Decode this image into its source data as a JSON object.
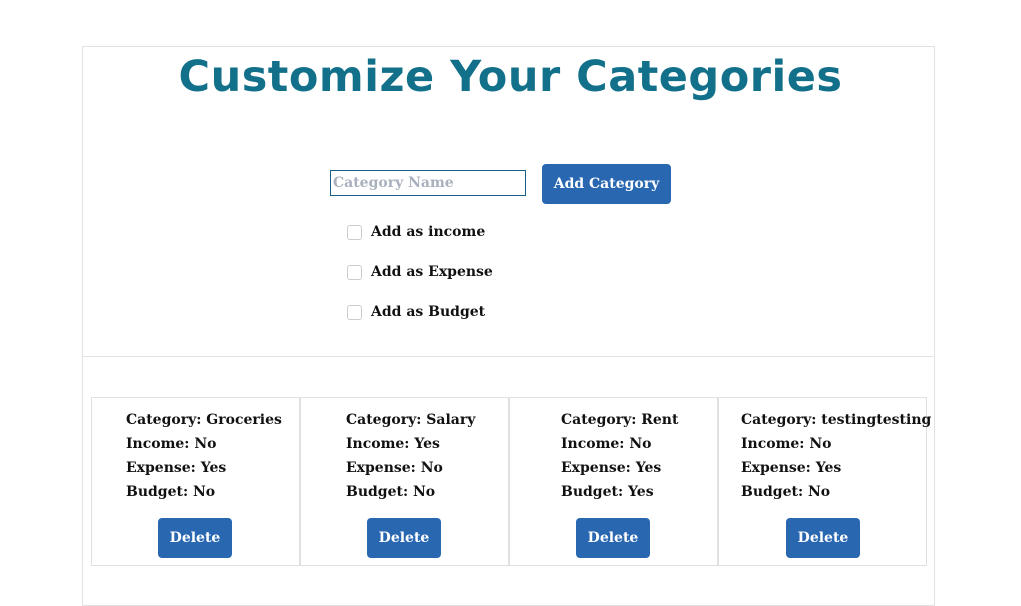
{
  "page": {
    "title": "Customize Your Categories"
  },
  "form": {
    "name_placeholder": "Category Name",
    "name_value": "",
    "add_button_label": "Add Category",
    "checkboxes": [
      {
        "label": "Add as income",
        "checked": false
      },
      {
        "label": "Add as Expense",
        "checked": false
      },
      {
        "label": "Add as Budget",
        "checked": false
      }
    ]
  },
  "categories": [
    {
      "category": "Category: Groceries",
      "income": "Income: No",
      "expense": "Expense: Yes",
      "budget": "Budget: No",
      "delete_label": "Delete"
    },
    {
      "category": "Category: Salary",
      "income": "Income: Yes",
      "expense": "Expense: No",
      "budget": "Budget: No",
      "delete_label": "Delete"
    },
    {
      "category": "Category: Rent",
      "income": "Income: No",
      "expense": "Expense: Yes",
      "budget": "Budget: Yes",
      "delete_label": "Delete"
    },
    {
      "category": "Category: testingtesting",
      "income": "Income: No",
      "expense": "Expense: Yes",
      "budget": "Budget: No",
      "delete_label": "Delete"
    }
  ],
  "colors": {
    "title": "#13708a",
    "button": "#2a67b1"
  }
}
